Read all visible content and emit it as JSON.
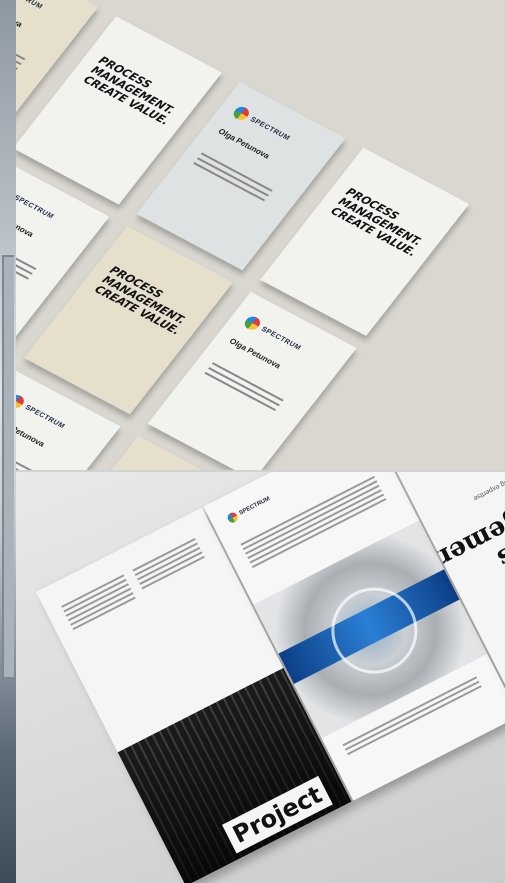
{
  "brand": {
    "logo_word": "SPECTRUM",
    "colors": {
      "logo_red": "#e53935",
      "logo_yellow": "#fbc02d",
      "logo_green": "#43a047",
      "logo_blue": "#1e88e5"
    }
  },
  "cards": {
    "slogan": "PROCESS MANAGEMENT. CREATE VALUE.",
    "person_name": "Olga Petunova"
  },
  "brochure": {
    "cover_heading": "Projects\nmanagement",
    "cover_subline": "full complex of engineering expertise",
    "back_title": "Project"
  }
}
